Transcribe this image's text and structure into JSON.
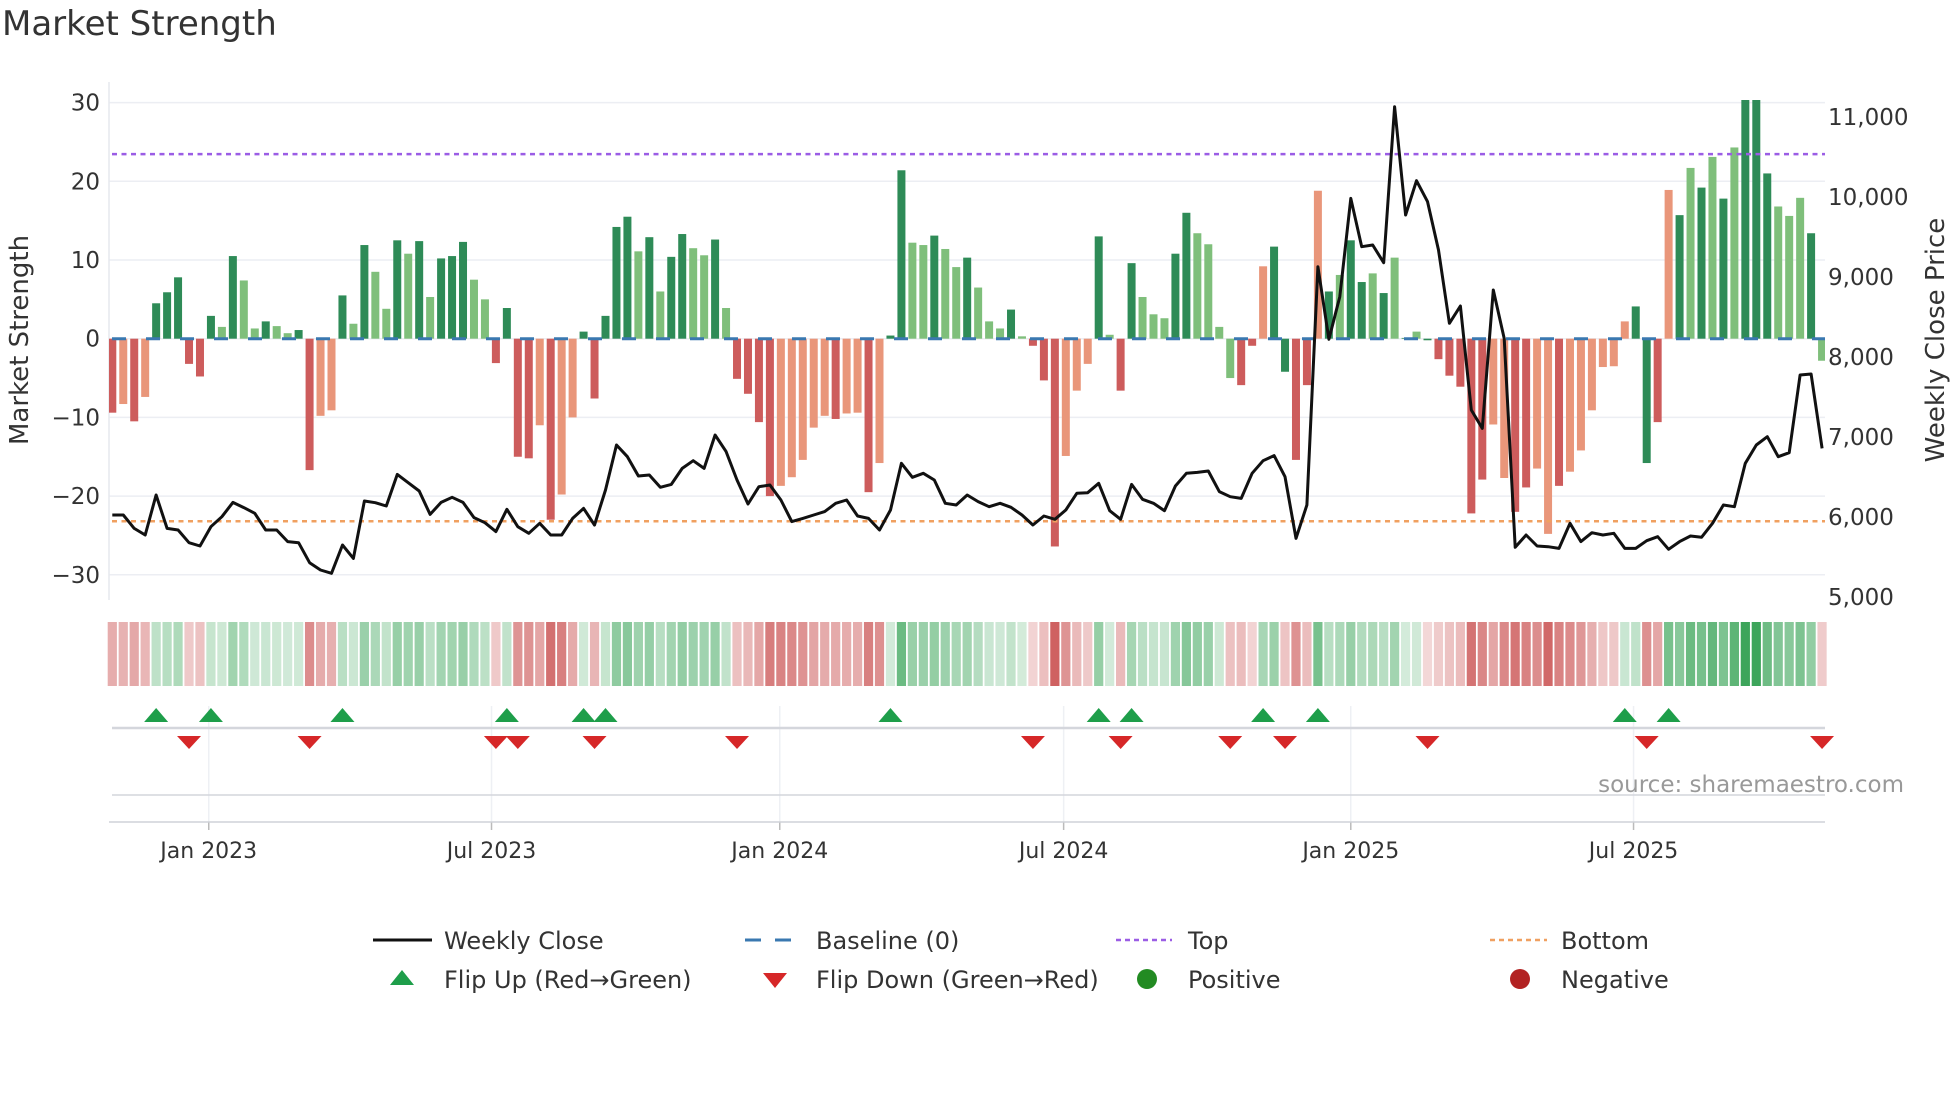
{
  "title": "Market Strength",
  "source": "source: sharemaestro.com",
  "colors": {
    "strong_green": "#2e8b57",
    "weak_green": "#7fbf7b",
    "strong_red": "#cd5c5c",
    "weak_red": "#e9967a",
    "close": "#111111",
    "baseline": "#3a78b0",
    "top": "#9b5de5",
    "bottom": "#f0a060",
    "flip_up": "#1e9e4a",
    "flip_down": "#d62728",
    "positive": "#228b22",
    "negative": "#b22222"
  },
  "legend": {
    "weekly_close": "Weekly Close",
    "baseline": "Baseline (0)",
    "top": "Top",
    "bottom": "Bottom",
    "flip_up": "Flip Up (Red→Green)",
    "flip_down": "Flip Down (Green→Red)",
    "positive": "Positive",
    "negative": "Negative"
  },
  "chart_data": {
    "type": "bar",
    "title": "Market Strength",
    "ylabel": "Market Strength",
    "y2label": "Weekly Close Price",
    "ylim": [
      -32.7,
      30.3
    ],
    "y2lim": [
      4970,
      11500
    ],
    "yticks": [
      {
        "v": 30,
        "label": "30"
      },
      {
        "v": 20,
        "label": "20"
      },
      {
        "v": 10,
        "label": "10"
      },
      {
        "v": 0,
        "label": "0"
      },
      {
        "v": -10,
        "label": "−10"
      },
      {
        "v": -20,
        "label": "−20"
      },
      {
        "v": -30,
        "label": "−30"
      }
    ],
    "y2ticks": [
      {
        "v": 11000,
        "label": "11,000"
      },
      {
        "v": 10000,
        "label": "10,000"
      },
      {
        "v": 9000,
        "label": "9,000"
      },
      {
        "v": 8000,
        "label": "8,000"
      },
      {
        "v": 7000,
        "label": "7,000"
      },
      {
        "v": 6000,
        "label": "6,000"
      },
      {
        "v": 5000,
        "label": "5,000"
      }
    ],
    "xticks": [
      {
        "week": 8.8,
        "label": "Jan 2023"
      },
      {
        "week": 34.6,
        "label": "Jul 2023"
      },
      {
        "week": 60.9,
        "label": "Jan 2024"
      },
      {
        "week": 86.8,
        "label": "Jul 2024"
      },
      {
        "week": 113,
        "label": "Jan 2025"
      },
      {
        "week": 138.8,
        "label": "Jul 2025"
      }
    ],
    "top_level": 23.45,
    "bottom_level": -23.2,
    "baseline": 0,
    "strength": [
      -9.4,
      -8.3,
      -10.5,
      -7.4,
      4.5,
      5.9,
      7.8,
      -3.2,
      -4.8,
      2.9,
      1.5,
      10.5,
      7.4,
      1.3,
      2.2,
      1.6,
      0.7,
      1.1,
      -16.7,
      -9.8,
      -9.1,
      5.5,
      1.9,
      11.9,
      8.5,
      3.8,
      12.5,
      10.8,
      12.4,
      5.3,
      10.2,
      10.5,
      12.3,
      7.5,
      5.0,
      -3.1,
      3.9,
      -15.0,
      -15.2,
      -11.0,
      -23.0,
      -19.8,
      -10.0,
      0.9,
      -7.6,
      2.9,
      14.2,
      15.5,
      11.1,
      12.9,
      6.0,
      10.4,
      13.3,
      11.5,
      10.6,
      12.6,
      3.9,
      -5.1,
      -7.0,
      -10.6,
      -20.0,
      -18.7,
      -17.6,
      -15.4,
      -11.3,
      -9.8,
      -10.2,
      -9.5,
      -9.4,
      -19.5,
      -15.8,
      0.4,
      21.4,
      12.2,
      11.9,
      13.1,
      11.4,
      9.1,
      10.3,
      6.5,
      2.2,
      1.3,
      3.7,
      0.3,
      -0.9,
      -5.3,
      -26.4,
      -14.9,
      -6.6,
      -3.2,
      13.0,
      0.5,
      -6.6,
      9.6,
      5.3,
      3.1,
      2.6,
      10.8,
      16.0,
      13.4,
      12.0,
      1.5,
      -5.0,
      -5.9,
      -0.9,
      9.2,
      11.7,
      -4.2,
      -15.4,
      -5.9,
      18.8,
      6.0,
      8.1,
      12.5,
      7.2,
      8.3,
      5.8,
      10.3,
      0.1,
      0.9,
      -0.2,
      -2.6,
      -4.7,
      -6.1,
      -22.2,
      -17.9,
      -10.9,
      -17.7,
      -22.0,
      -18.9,
      -16.5,
      -24.8,
      -18.7,
      -16.9,
      -14.2,
      -9.1,
      -3.6,
      -3.5,
      2.2,
      4.1,
      -15.8,
      -10.6,
      18.9,
      15.7,
      21.7,
      19.2,
      23.1,
      17.8,
      24.3,
      31,
      31,
      21.0,
      16.8,
      15.6,
      17.9,
      13.4,
      -2.8
    ],
    "strength_class": "RrRrGGGRRGgGggGggGRrrGgGggGgGgGGGggRGRRrRrrGRGGGgGgGGggGgRRRRrrrrrRrrRrGGggGggGgggGgRRRrrrGgRGgggGGggggRRrGGRRrGgGGgGgGgGRRRRRrrRRrrRrrrrrrGGRrGgGgGgGGGgggGgR",
    "weekly_close": [
      6025,
      6025,
      5858,
      5775,
      6275,
      5858,
      5838,
      5679,
      5637,
      5879,
      6004,
      6183,
      6117,
      6046,
      5838,
      5838,
      5692,
      5679,
      5429,
      5338,
      5296,
      5650,
      5483,
      6200,
      6179,
      6137,
      6533,
      6429,
      6325,
      6033,
      6183,
      6246,
      6183,
      5992,
      5929,
      5817,
      6096,
      5879,
      5796,
      5921,
      5775,
      5775,
      5983,
      6108,
      5900,
      6338,
      6900,
      6754,
      6513,
      6525,
      6371,
      6408,
      6608,
      6704,
      6608,
      7025,
      6817,
      6463,
      6163,
      6379,
      6400,
      6213,
      5942,
      5983,
      6025,
      6067,
      6171,
      6213,
      6012,
      5983,
      5838,
      6088,
      6671,
      6496,
      6546,
      6463,
      6171,
      6150,
      6275,
      6192,
      6129,
      6171,
      6121,
      6025,
      5900,
      6012,
      5971,
      6088,
      6296,
      6304,
      6421,
      6079,
      5971,
      6408,
      6221,
      6171,
      6079,
      6388,
      6546,
      6558,
      6575,
      6317,
      6254,
      6233,
      6546,
      6704,
      6767,
      6504,
      5733,
      6150,
      9129,
      8221,
      8754,
      9983,
      9379,
      9400,
      9179,
      11129,
      9775,
      10204,
      9942,
      9337,
      8421,
      8638,
      7338,
      7108,
      8838,
      8233,
      5621,
      5775,
      5637,
      5629,
      5608,
      5921,
      5692,
      5804,
      5775,
      5796,
      5608,
      5608,
      5704,
      5754,
      5596,
      5692,
      5763,
      5746,
      5921,
      6150,
      6129,
      6671,
      6900,
      7004,
      6754,
      6804,
      7775,
      7788,
      6858
    ],
    "flip_up_weeks": [
      4,
      9,
      21,
      36,
      43,
      45,
      71,
      90,
      93,
      105,
      110,
      138,
      142
    ],
    "flip_down_weeks": [
      7,
      18,
      35,
      37,
      44,
      57,
      84,
      92,
      102,
      107,
      120,
      140,
      156
    ]
  }
}
